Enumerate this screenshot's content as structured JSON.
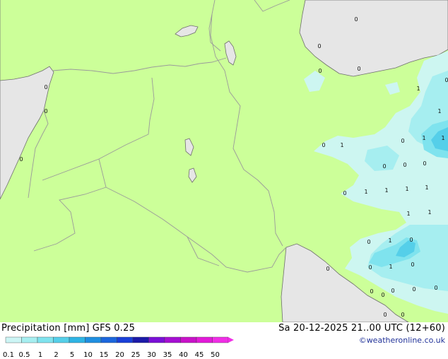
{
  "title": "Precipitation [mm]  GFS 0.25",
  "valid_time": "Sa 20-12-2025 21..00 UTC (12+60)",
  "credit": "©weatheronline.co.uk",
  "colors": {
    "land": "#ccff99",
    "sea": "#e6e6e6",
    "border": "#9a9a9a",
    "coast": "#6e6e6e"
  },
  "legend": {
    "ticks": [
      "0.1",
      "0.5",
      "1",
      "2",
      "5",
      "10",
      "15",
      "20",
      "25",
      "30",
      "35",
      "40",
      "45",
      "50"
    ],
    "colors": [
      "#ccf5f5",
      "#a6eef0",
      "#7fe3ee",
      "#55cfe9",
      "#2fb4e4",
      "#1f8fe0",
      "#1c66dc",
      "#1a3fd7",
      "#1c1aa8",
      "#7a10d6",
      "#a50fd2",
      "#c812c8",
      "#e21ad8",
      "#f02ee6"
    ]
  },
  "map_labels": [
    "0",
    "0",
    "0",
    "0",
    "0",
    "1",
    "0",
    "1",
    "1",
    "1",
    "0",
    "1",
    "0",
    "0",
    "0",
    "0",
    "1",
    "1",
    "1",
    "1",
    "1",
    "1",
    "1",
    "0",
    "0",
    "1",
    "0",
    "0",
    "0",
    "0",
    "0",
    "0",
    "0",
    "0",
    "0",
    "0",
    "0",
    "0",
    "0"
  ]
}
